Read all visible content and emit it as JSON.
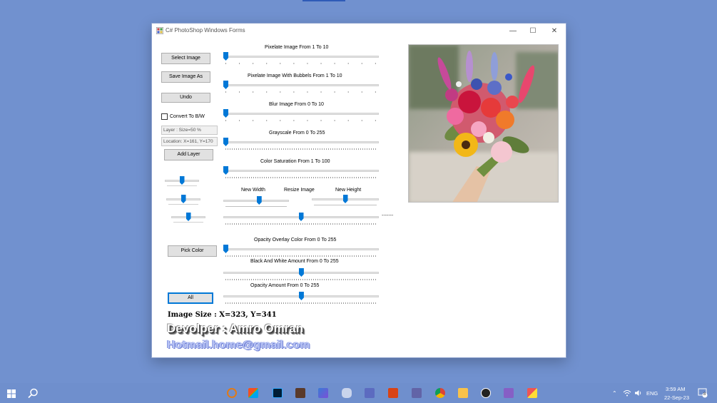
{
  "window": {
    "title": "C# PhotoShop Windows Forms",
    "minimize": "—",
    "maximize": "☐",
    "close": "✕"
  },
  "buttons": {
    "select_image": "Select Image",
    "save_image_as": "Save Image As",
    "undo": "Undo",
    "add_layer": "Add Layer",
    "pick_color": "Pick Color",
    "all": "All"
  },
  "checkbox": {
    "convert_bw": "Convert To B/W",
    "checked": false
  },
  "fields": {
    "layer_size": "Layer : Size=50 %",
    "location": "Location: X=161, Y=170"
  },
  "sliders": {
    "pixelate": {
      "label": "Pixelate Image From 1 To 10",
      "value": 1,
      "min": 1,
      "max": 10
    },
    "pixelate_bubbles": {
      "label": "Pixelate Image With Bubbels From 1 To 10",
      "value": 1,
      "min": 1,
      "max": 10
    },
    "blur": {
      "label": "Blur Image From 0 To 10",
      "value": 0,
      "min": 0,
      "max": 10
    },
    "grayscale": {
      "label": "Grayscale From 0 To 255",
      "value": 0,
      "min": 0,
      "max": 255
    },
    "saturation": {
      "label": "Color Saturation From 1 To 100",
      "value": 1,
      "min": 1,
      "max": 100
    },
    "new_width": {
      "label": "New Width",
      "level": 0.55
    },
    "resize": {
      "label": "Resize Image",
      "level": 0.5
    },
    "new_height": {
      "label": "New Height",
      "level": 0.5
    },
    "opacity_overlay": {
      "label": "Opacity Overlay Color From 0 To 255",
      "value": 0,
      "min": 0,
      "max": 255
    },
    "bw_amount": {
      "label": "Black And White Amount From 0 To 255",
      "value": 128,
      "min": 0,
      "max": 255
    },
    "opacity_amount": {
      "label": "Opacity Amount From 0 To 255",
      "value": 128,
      "min": 0,
      "max": 255
    },
    "side_levels": [
      0.5,
      0.5,
      0.5
    ]
  },
  "resize_readout": "-------",
  "info": {
    "image_size": "Image Size : X=323, Y=341",
    "developer": "Devolper : Amro Omran",
    "email": "Hotmail.home@gmail.com"
  },
  "taskbar": {
    "time": "3:59 AM",
    "date": "22-Sep-23",
    "language": "ENG",
    "notification_count": "8",
    "apps": [
      "search-app-icon",
      "store-icon",
      "photoshop-icon",
      "photo-viewer-icon",
      "app-icon",
      "gamepad-icon",
      "visual-studio-code-icon",
      "tools-icon",
      "teams-icon",
      "chrome-icon",
      "file-explorer-icon",
      "obs-icon",
      "visual-studio-icon",
      "winforms-app-icon"
    ]
  },
  "colors": {
    "desktop": "#7191cf",
    "accent": "#0078d7",
    "button_bg": "#e1e1e1"
  }
}
